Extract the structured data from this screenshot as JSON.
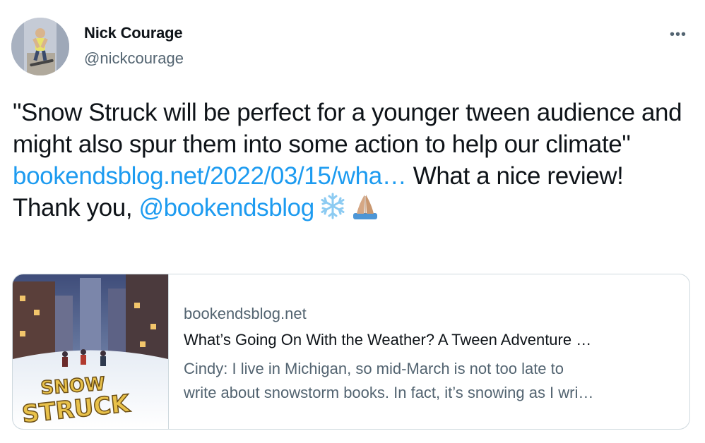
{
  "author": {
    "name": "Nick Courage",
    "handle": "@nickcourage"
  },
  "more_label": "•••",
  "tweet": {
    "text_part1": "\"Snow Struck will be perfect for a younger tween audience and might also spur them into some action to help our climate\"",
    "link_text": "bookendsblog.net/2022/03/15/wha…",
    "text_part2": "What a nice review! Thank you,",
    "mention": "@bookendsblog",
    "emojis": [
      "snowflake-emoji",
      "folded-hands-emoji"
    ]
  },
  "card": {
    "domain": "bookendsblog.net",
    "title": "What’s Going On With the Weather? A Tween Adventure …",
    "description_line1": "Cindy: I live in Michigan, so mid-March is not too late to",
    "description_line2": "write about snowstorm books. In fact, it’s snowing as I wri…",
    "image_title": "SNOW STRUCK"
  },
  "colors": {
    "link": "#1d9bf0",
    "secondary": "#536471",
    "border": "#cfd9de"
  }
}
